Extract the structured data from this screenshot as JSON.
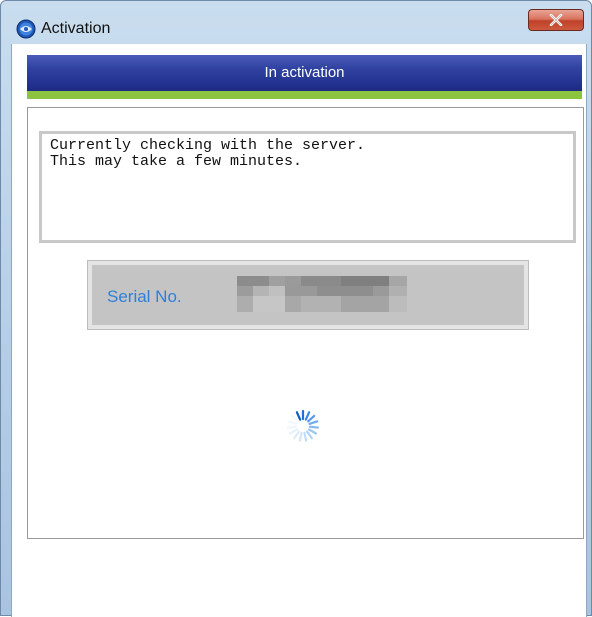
{
  "window": {
    "title": "Activation",
    "close_symbol": "x"
  },
  "banner": {
    "title": "In activation",
    "accent_color": "#8dc43f",
    "banner_color": "#1d2b86"
  },
  "message": {
    "lines": [
      "Currently checking with the server.",
      "This may take a few minutes."
    ]
  },
  "serial": {
    "label": "Serial No.",
    "value_obscured": true
  },
  "icons": {
    "app": "app-globe-icon",
    "close": "close-icon",
    "spinner": "loading-spinner-icon"
  }
}
